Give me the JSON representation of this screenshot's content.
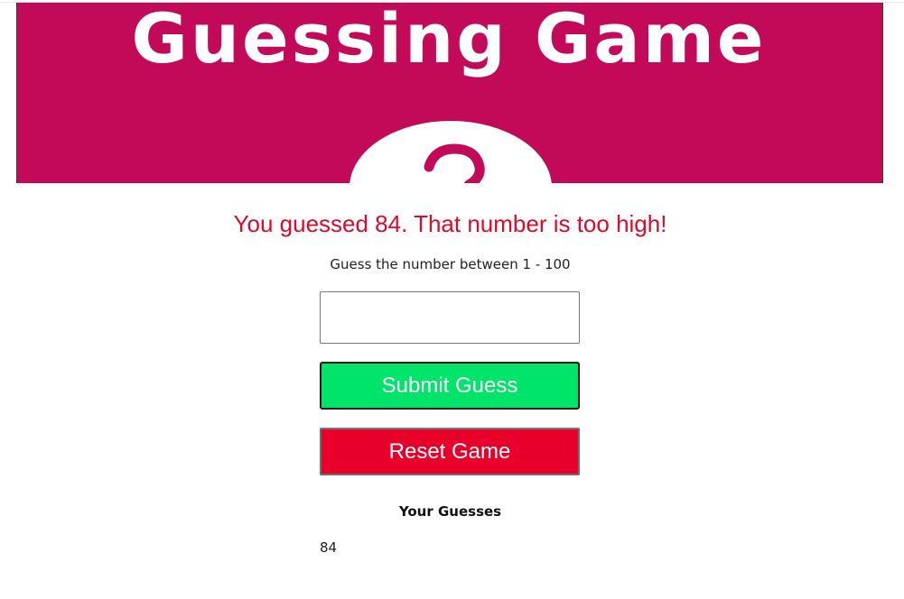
{
  "banner": {
    "title": "Guessing Game",
    "background": "#c20a58",
    "decoration": "question-mark-bubble"
  },
  "status": {
    "message": "You guessed 84. That number is too high!",
    "color": "#dc0a2c"
  },
  "instruction": "Guess the number between 1 - 100",
  "input": {
    "value": "",
    "placeholder": ""
  },
  "buttons": {
    "submit_label": "Submit Guess",
    "submit_color": "#00e46a",
    "reset_label": "Reset Game",
    "reset_color": "#e8002a"
  },
  "guesses": {
    "heading": "Your Guesses",
    "items": [
      "84"
    ]
  }
}
